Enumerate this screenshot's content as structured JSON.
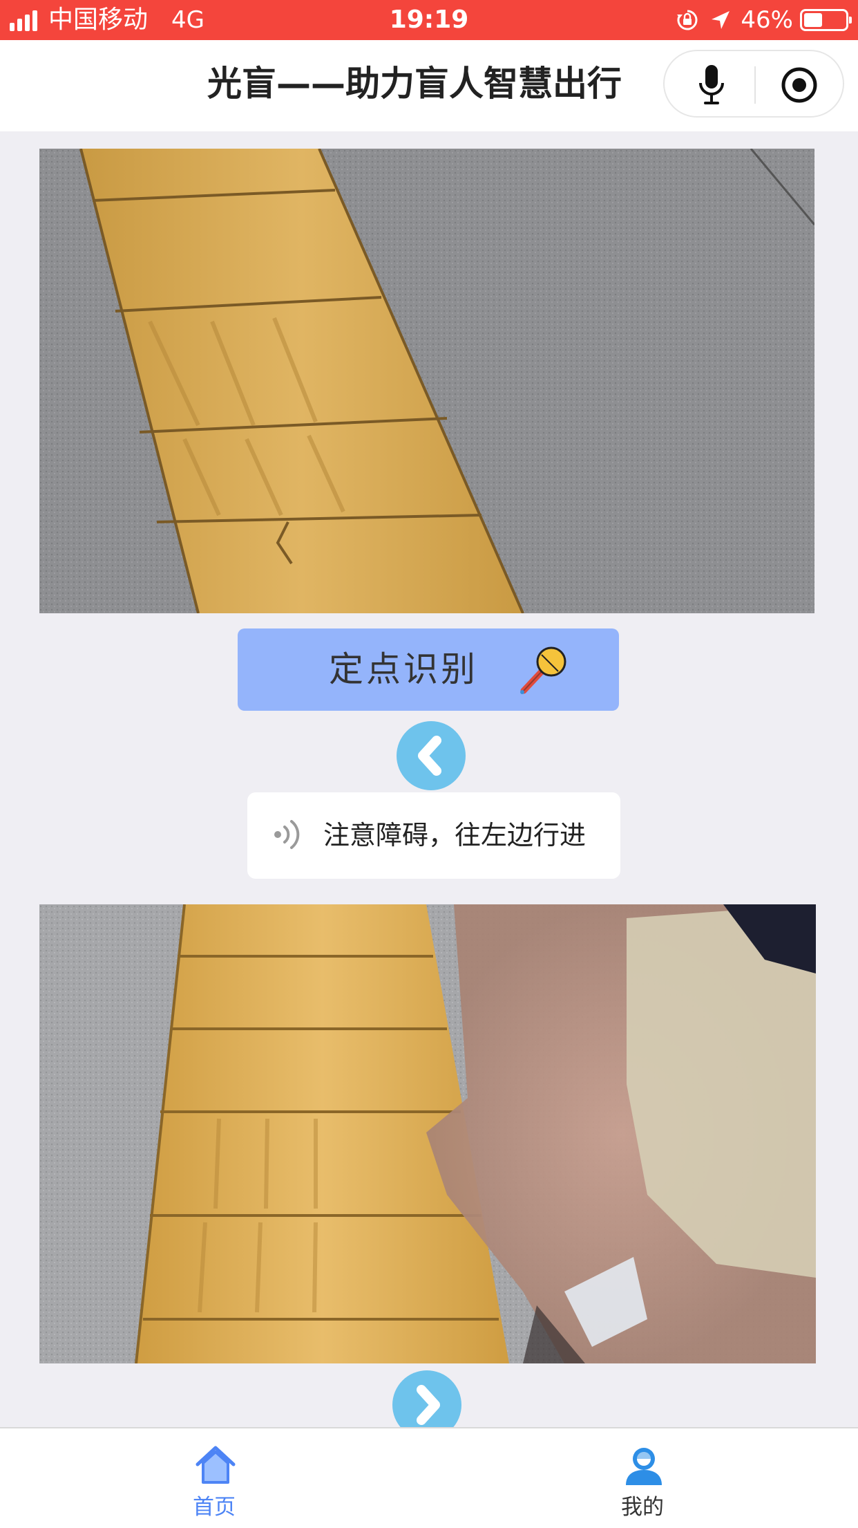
{
  "status_bar": {
    "carrier": "中国移动",
    "network": "4G",
    "time": "19:19",
    "battery_percent": "46%",
    "battery_level": 0.46,
    "icons": [
      "signal-icon",
      "rotation-lock-icon",
      "location-arrow-icon",
      "battery-icon"
    ]
  },
  "header": {
    "title": "光盲——助力盲人智慧出行",
    "capsule_icons": [
      "microphone-icon",
      "target-icon"
    ]
  },
  "main": {
    "detect_button": {
      "label": "定点识别",
      "icon": "colored-microphone-icon"
    },
    "prev_icon": "chevron-left-icon",
    "next_icon": "chevron-right-icon",
    "hint": {
      "icon": "speaker-wave-icon",
      "text": "注意障碍，往左边行进"
    }
  },
  "tabbar": {
    "items": [
      {
        "label": "首页",
        "icon": "home-icon",
        "active": true
      },
      {
        "label": "我的",
        "icon": "user-icon",
        "active": false
      }
    ]
  },
  "colors": {
    "status_bar": "#f4453c",
    "detect_button": "#94b4fb",
    "circle_button": "#6ec3ec",
    "tab_active": "#4d84f5",
    "tactile_paving": "#d9a84e"
  }
}
